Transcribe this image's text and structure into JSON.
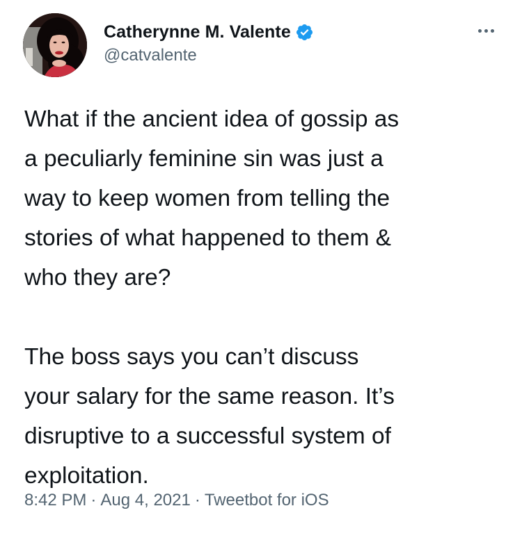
{
  "author": {
    "display_name": "Catherynne M. Valente",
    "handle": "@catvalente",
    "verified": true,
    "verified_badge_color": "#1d9bf0",
    "avatar_icon": "profile-photo"
  },
  "menu": {
    "icon": "more-options-icon"
  },
  "tweet": {
    "paragraph1": [
      "What if the ancient idea of gossip as",
      "a peculiarly feminine sin was just a",
      "way to keep women from telling the",
      "stories of what happened to them &",
      "who they are?"
    ],
    "paragraph2": [
      "The boss says you can’t discuss",
      "your salary for the same reason. It’s",
      "disruptive to a successful system of",
      "exploitation."
    ]
  },
  "meta": {
    "time": "8:42 PM",
    "separator": "·",
    "date": "Aug 4, 2021",
    "source": "Tweetbot for iOS"
  },
  "colors": {
    "text": "#0f1419",
    "secondary": "#536471",
    "background": "#ffffff"
  }
}
